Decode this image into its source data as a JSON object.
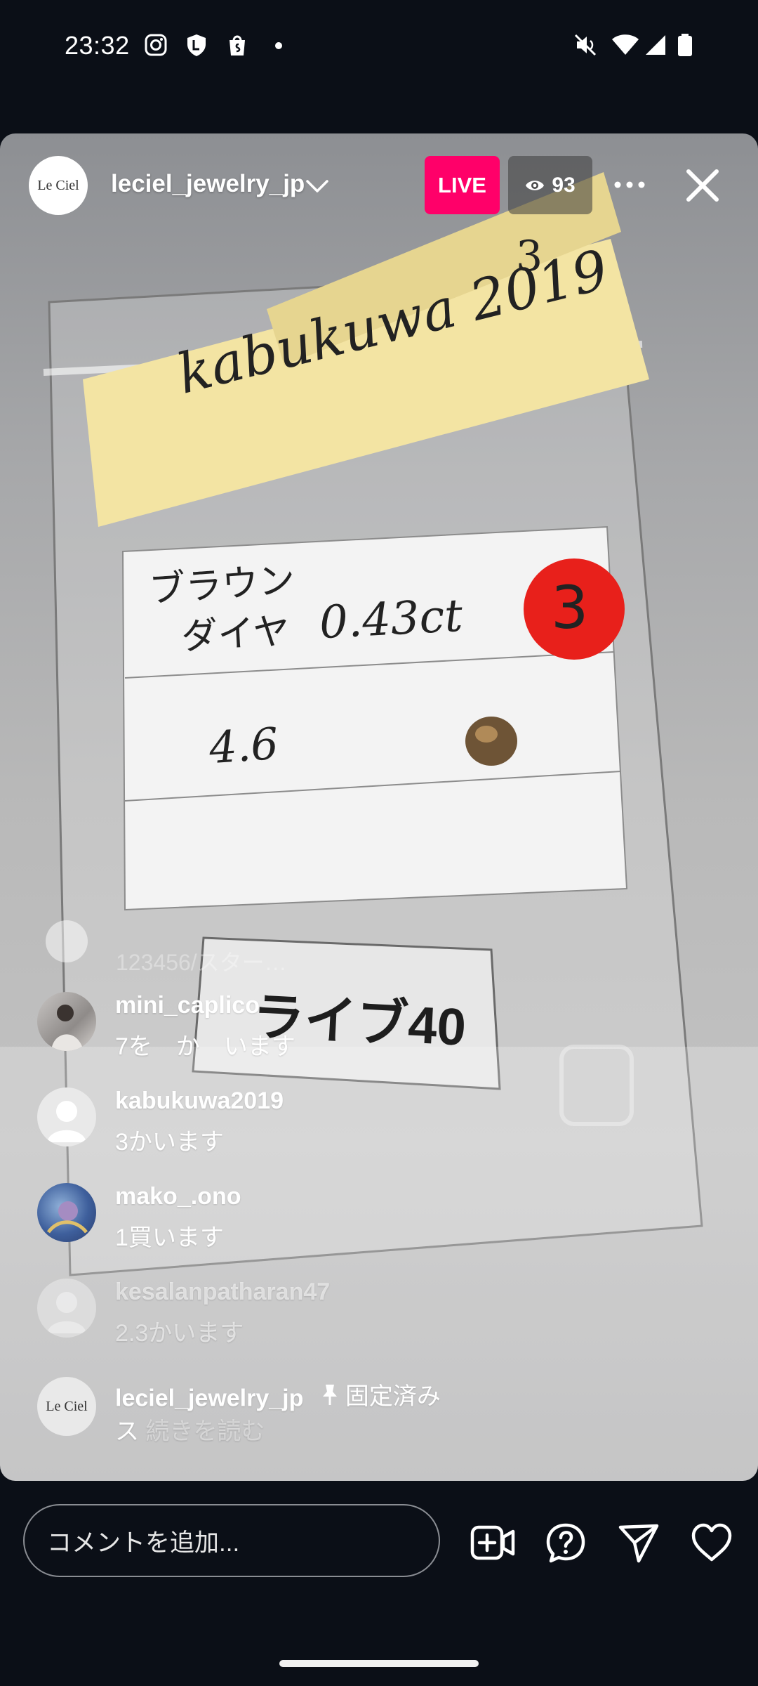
{
  "status_bar": {
    "time": "23:32",
    "left_icons": [
      "instagram-icon",
      "shield-icon",
      "shopping-bag-icon",
      "notification-dot"
    ],
    "right_icons": [
      "mute-icon",
      "wifi-icon",
      "signal-icon",
      "battery-icon"
    ]
  },
  "live": {
    "host_name": "leciel_jewelry_jp",
    "host_logo_text": "Le Ciel",
    "live_label": "LIVE",
    "viewer_count": "93"
  },
  "video": {
    "sticky_note_number": "3",
    "sticky_note_text": "kabukuwa 2019",
    "card_line_1": "ブラウン",
    "card_line_2": "ダイヤ",
    "card_carat": "0.43ct",
    "card_number": "4.6",
    "red_sticker_number": "3",
    "bottom_card_text": "ライブ40",
    "peeking_comment": "123456/スター…"
  },
  "comments": [
    {
      "user": "mini_caplico",
      "text": "7を　か　います",
      "avatar": "photo-avatar"
    },
    {
      "user": "kabukuwa2019",
      "text": "3かいます",
      "avatar": "default-avatar"
    },
    {
      "user": "mako_.ono",
      "text": "1買います",
      "avatar": "photo-avatar"
    },
    {
      "user": "kesalanpatharan47",
      "text": "2.3かいます",
      "avatar": "default-avatar"
    },
    {
      "user": "leciel_jewelry_jp",
      "pinned_label": "固定済み",
      "text": "ス",
      "read_more": "続きを読む",
      "avatar": "logo-avatar"
    }
  ],
  "bottom_bar": {
    "comment_placeholder": "コメントを追加...",
    "icons": [
      "add-video-icon",
      "question-icon",
      "send-icon",
      "heart-icon"
    ]
  },
  "colors": {
    "live_badge": "#ff0069",
    "background": "#0b0f17"
  }
}
